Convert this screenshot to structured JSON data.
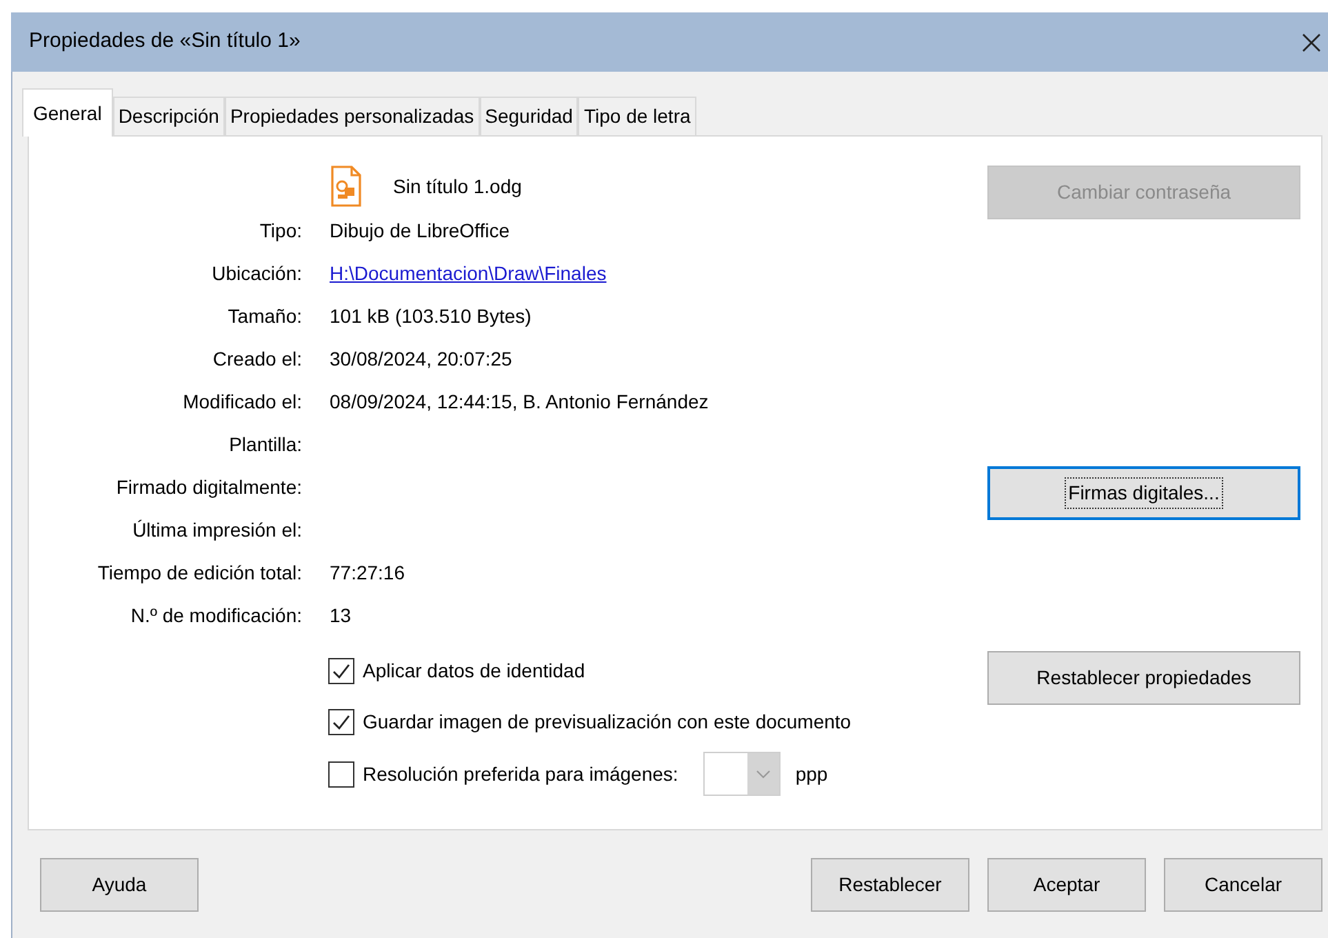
{
  "window": {
    "title": "Propiedades de «Sin título 1»"
  },
  "tabs": [
    {
      "label": "General",
      "selected": true
    },
    {
      "label": "Descripción",
      "selected": false
    },
    {
      "label": "Propiedades personalizadas",
      "selected": false
    },
    {
      "label": "Seguridad",
      "selected": false
    },
    {
      "label": "Tipo de letra",
      "selected": false
    }
  ],
  "document": {
    "file_name": "Sin título 1.odg"
  },
  "properties": [
    {
      "label": "Tipo:",
      "value": "Dibujo de LibreOffice",
      "kind": "text"
    },
    {
      "label": "Ubicación:",
      "value": "H:\\Documentacion\\Draw\\Finales",
      "kind": "link"
    },
    {
      "label": "Tamaño:",
      "value": "101 kB (103.510 Bytes)",
      "kind": "text"
    },
    {
      "label": "Creado el:",
      "value": "30/08/2024, 20:07:25",
      "kind": "text"
    },
    {
      "label": "Modificado el:",
      "value": "08/09/2024, 12:44:15, B. Antonio Fernández",
      "kind": "text"
    },
    {
      "label": "Plantilla:"
    },
    {
      "label": "Firmado digitalmente:"
    },
    {
      "label": "Última impresión el:"
    },
    {
      "label": "Tiempo de edición total:",
      "value": "77:27:16",
      "kind": "text"
    },
    {
      "label": "N.º de modificación:",
      "value": "13",
      "kind": "text"
    }
  ],
  "side_buttons": [
    {
      "label": "Cambiar contraseña",
      "disabled": true,
      "focused": false
    },
    {
      "label": "Firmas digitales...",
      "disabled": false,
      "focused": true
    },
    {
      "label": "Restablecer propiedades",
      "disabled": false,
      "focused": false
    }
  ],
  "options": [
    {
      "label": "Aplicar datos de identidad",
      "checked": true
    },
    {
      "label": "Guardar imagen de previsualización con este documento",
      "checked": true
    },
    {
      "label": "Resolución preferida para imágenes:",
      "checked": false,
      "unit": "ppp"
    }
  ],
  "footer_buttons": [
    "Ayuda",
    "Restablecer",
    "Aceptar",
    "Cancelar"
  ]
}
